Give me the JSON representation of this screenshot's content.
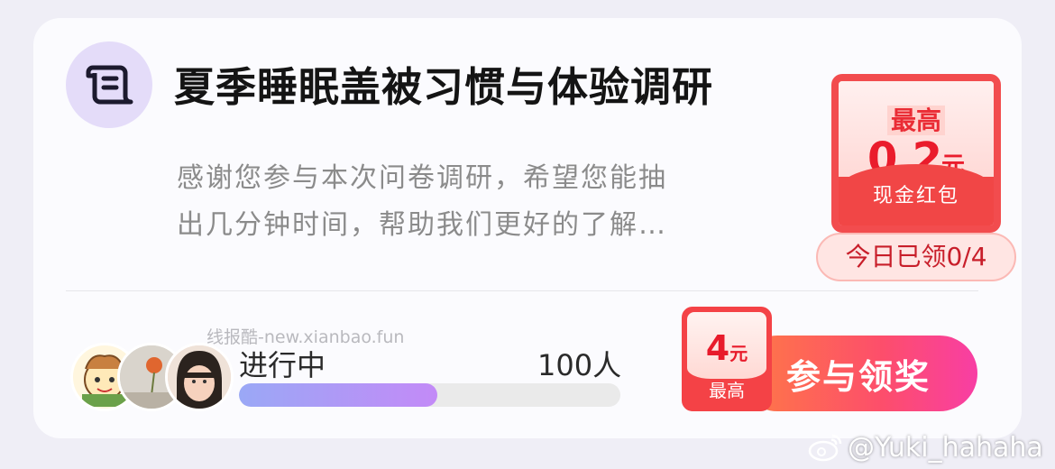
{
  "survey": {
    "title": "夏季睡眠盖被习惯与体验调研",
    "description_line1": "感谢您参与本次问卷调研，希望您能抽",
    "description_line2": "出几分钟时间，帮助我们更好的了解…",
    "icon": "scroll-document-icon"
  },
  "reward_badge": {
    "label": "最高",
    "amount": "0.2",
    "unit": "元",
    "type_label": "现金红包",
    "claimed_text": "今日已领0/4"
  },
  "progress": {
    "status": "进行中",
    "participants": "100人",
    "fill_fraction": 0.52
  },
  "join": {
    "max_amount": "4",
    "max_unit": "元",
    "max_label": "最高",
    "button_label": "参与领奖"
  },
  "watermarks": {
    "site": "线报酷-new.xianbao.fun",
    "weibo": "@Yuki_hahaha"
  },
  "colors": {
    "accent_red": "#f24c4e",
    "join_gradient_start": "#fe7a45",
    "join_gradient_end": "#f83ea4",
    "progress_start": "#9aa8f6",
    "progress_end": "#c38af7"
  }
}
